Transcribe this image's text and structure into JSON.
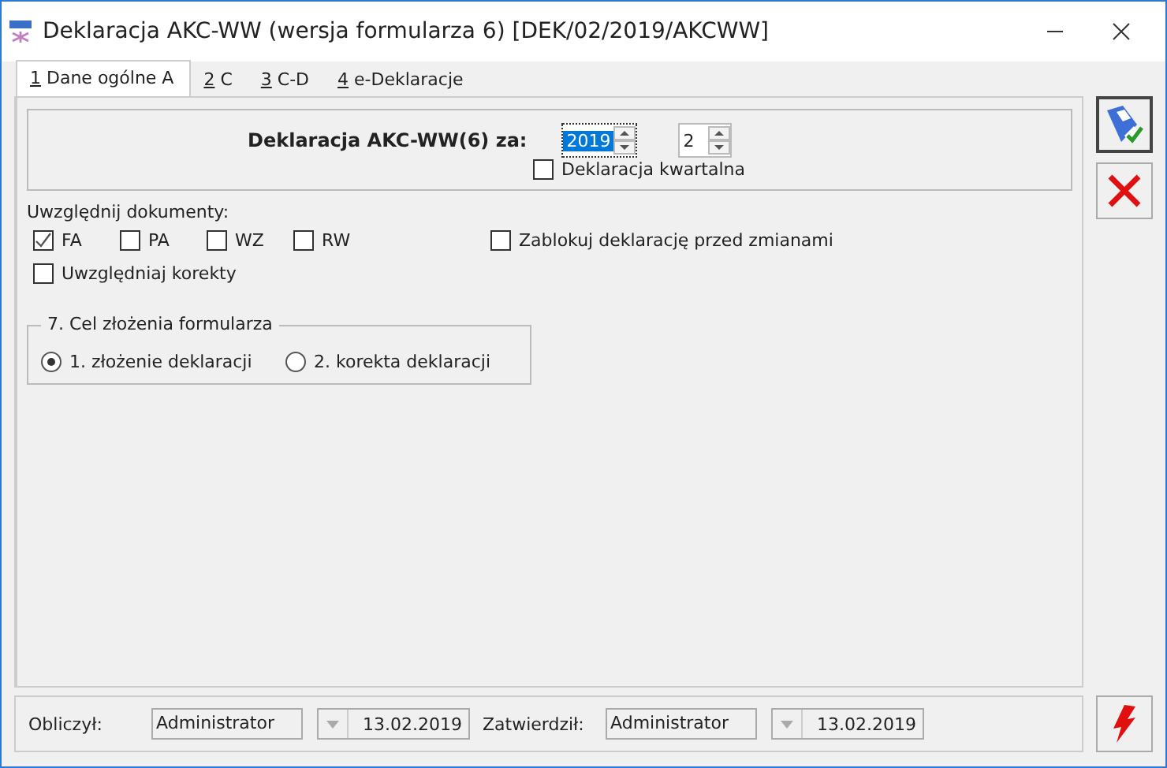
{
  "window": {
    "title": "Deklaracja AKC-WW (wersja formularza 6) [DEK/02/2019/AKCWW]"
  },
  "tabs": [
    {
      "key": "1",
      "label": "Dane ogólne A",
      "selected": true
    },
    {
      "key": "2",
      "label": "C",
      "selected": false
    },
    {
      "key": "3",
      "label": "C-D",
      "selected": false
    },
    {
      "key": "4",
      "label": "e-Deklaracje",
      "selected": false
    }
  ],
  "header": {
    "title": "Deklaracja AKC-WW(6) za:",
    "year": "2019",
    "month": "2",
    "quarterly": {
      "label": "Deklaracja kwartalna",
      "checked": false
    }
  },
  "documents": {
    "label": "Uwzględnij dokumenty:",
    "items": [
      {
        "label": "FA",
        "checked": true
      },
      {
        "label": "PA",
        "checked": false
      },
      {
        "label": "WZ",
        "checked": false
      },
      {
        "label": "RW",
        "checked": false
      }
    ],
    "lock": {
      "label": "Zablokuj deklarację przed zmianami",
      "checked": false
    },
    "corrections": {
      "label": "Uwzględniaj korekty",
      "checked": false
    }
  },
  "purpose": {
    "title": "7. Cel złożenia formularza",
    "options": [
      {
        "label": "1. złożenie deklaracji",
        "selected": true
      },
      {
        "label": "2. korekta deklaracji",
        "selected": false
      }
    ]
  },
  "footer": [
    {
      "label": "Obliczył:",
      "user": "Administrator",
      "date": "13.02.2019"
    },
    {
      "label": "Zatwierdził:",
      "user": "Administrator",
      "date": "13.02.2019"
    }
  ]
}
